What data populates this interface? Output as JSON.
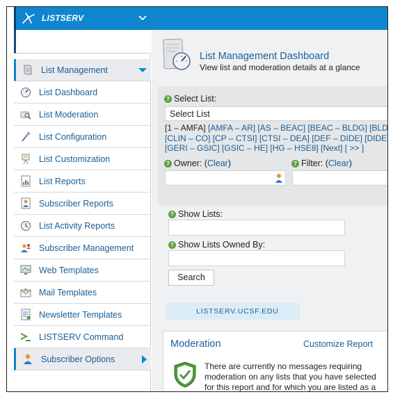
{
  "app": {
    "brand": "LISTSERV"
  },
  "sidebar": {
    "items": [
      {
        "label": "List Management",
        "icon": "scroll-icon"
      },
      {
        "label": "List Dashboard",
        "icon": "gauge-icon"
      },
      {
        "label": "List Moderation",
        "icon": "magnifier-icon"
      },
      {
        "label": "List Configuration",
        "icon": "wrench-icon"
      },
      {
        "label": "List Customization",
        "icon": "easel-icon"
      },
      {
        "label": "List Reports",
        "icon": "report-icon"
      },
      {
        "label": "Subscriber Reports",
        "icon": "subscriber-report-icon"
      },
      {
        "label": "List Activity Reports",
        "icon": "clock-icon"
      },
      {
        "label": "Subscriber Management",
        "icon": "users-icon"
      },
      {
        "label": "Web Templates",
        "icon": "monitor-icon"
      },
      {
        "label": "Mail Templates",
        "icon": "mail-icon"
      },
      {
        "label": "Newsletter Templates",
        "icon": "newsletter-icon"
      },
      {
        "label": "LISTSERV Command",
        "icon": "command-icon"
      },
      {
        "label": "Subscriber Options",
        "icon": "user-icon"
      }
    ]
  },
  "header": {
    "title": "List Management Dashboard",
    "subtitle": "View list and moderation details at a glance"
  },
  "filters": {
    "select_list_label": "Select List:",
    "select_list_value": "Select List",
    "ranges": [
      {
        "text": "[1 – AMFA]",
        "link": false
      },
      {
        "text": "[AMFA – AR]",
        "link": true
      },
      {
        "text": "[AS – BEAC]",
        "link": true
      },
      {
        "text": "[BEAC – BLDG]",
        "link": true
      },
      {
        "text": "[BLDG",
        "link": true
      },
      {
        "text": "[CLIN – CO]",
        "link": true
      },
      {
        "text": "[CP – CTSI]",
        "link": true
      },
      {
        "text": "[CTSI – DEA]",
        "link": true
      },
      {
        "text": "[DEF – DIDE]",
        "link": true
      },
      {
        "text": "[DIDE –",
        "link": true
      },
      {
        "text": "[GERI – GSIC]",
        "link": true
      },
      {
        "text": "[GSIC – HE]",
        "link": true
      },
      {
        "text": "[HG – HSE8]",
        "link": true
      },
      {
        "text": "[Next]",
        "link": true
      },
      {
        "text": "[ >> ]",
        "link": true
      }
    ],
    "owner_label": "Owner:",
    "filter_label": "Filter:",
    "clear_label": "Clear",
    "show_lists_label": "Show Lists:",
    "show_lists_owned_label": "Show Lists Owned By:",
    "search_label": "Search"
  },
  "server": {
    "name": "LISTSERV.UCSF.EDU"
  },
  "moderation": {
    "title": "Moderation",
    "customize_label": "Customize Report",
    "message": "There are currently no messages requiring moderation on any lists that you have selected for this report and for which you are listed as a moderator. Follow the"
  },
  "colors": {
    "accent": "#0f86cf",
    "link": "#1b5e95",
    "sidebar_bg": "#ffffff",
    "content_bg": "#f0f1f2"
  }
}
